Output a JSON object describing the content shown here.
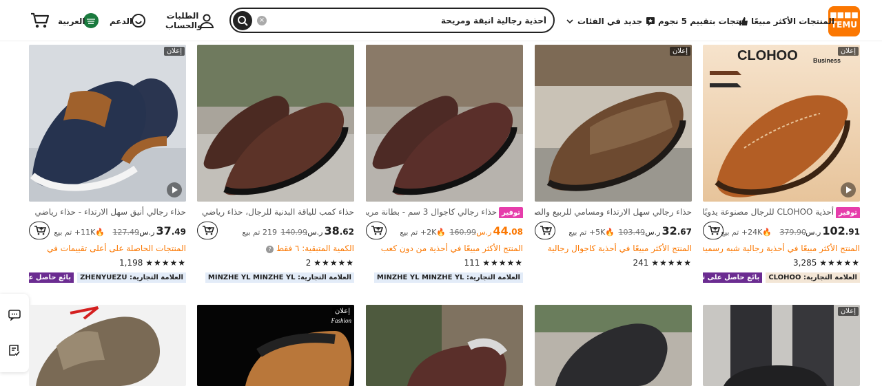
{
  "header": {
    "logo_top": "■■■■",
    "logo_bottom": "TEMU",
    "nav_best_sellers": "المنتجات الأكثر مبيعًا",
    "nav_five_star": "منتجات بتقييم 5 نجوم",
    "nav_new": "جديد في",
    "nav_categories": "الفئات",
    "search_value": "أحذية رجالية انيقة ومريحة",
    "orders_line1": "الطلبات",
    "orders_line2": "والحساب",
    "support": "الدعم",
    "language": "العربية"
  },
  "products": [
    {
      "ad": "إعلان",
      "save": "توفير",
      "title": "أحذية CLOHOO للرجال مصنوعة يدويًا",
      "price_int": "102",
      "price_dec": ".91",
      "currency": "ر.س.",
      "old_price": "379.90",
      "sold": "24K+ تم بيع",
      "tag": "المنتج الأكثر مبيعًا في أحذية رجالية شبه رسمية",
      "rating_count": "3,285",
      "brand": "العلامة التجارية: CLOHOO",
      "seller": "بائع حاصل على تقييمات"
    },
    {
      "ad": "إعلان",
      "title": "حذاء رجالي سهل الارتداء ومسامي للربيع والصيف",
      "price_int": "32",
      "price_dec": ".67",
      "currency": "ر.س.",
      "old_price": "103.49",
      "sold": "5K+ تم بيع",
      "tag": "المنتج الأكثر مبيعًا في أحذية كاجوال رجالية",
      "rating_count": "241"
    },
    {
      "save": "توفير",
      "title": "حذاء رجالي كاجوال 3 سم - بطانة مريحة",
      "price_int": "44",
      "price_dec": ".08",
      "currency": "ر.س.",
      "old_price": "160.99",
      "sold": "2K+ تم بيع",
      "tag": "المنتج الأكثر مبيعًا في أحذية من دون كعب",
      "rating_count": "111",
      "brand": "العلامة التجارية: MINZHE YL MINZHE YL"
    },
    {
      "title": "حذاء كمب للياقة البدنية للرجال، حذاء رياضي",
      "price_int": "38",
      "price_dec": ".62",
      "currency": "ر.س.",
      "old_price": "140.99",
      "sold": "219 تم بيع",
      "tag": "الكمية المتبقية: ٦ فقط",
      "rating_count": "2",
      "brand": "العلامة التجارية: MINZHE YL MINZHE YL"
    },
    {
      "ad": "إعلان",
      "title": "حذاء رجالي أنيق سهل الارتداء - حذاء رياضي",
      "price_int": "37",
      "price_dec": ".49",
      "currency": "ر.س.",
      "old_price": "127.49",
      "sold": "11K+ تم بيع",
      "tag": "المنتجات الحاصلة على أعلى تقييمات في",
      "rating_count": "1,198",
      "brand": "العلامة التجارية: ZHENYUEZU",
      "seller": "بائع حاصل على نجوم"
    }
  ],
  "second_row_ads": [
    "إعلان",
    "",
    "",
    "",
    "إعلان"
  ],
  "second_row_label": "Fashion",
  "stars": "★★★★★",
  "colors": {
    "accent": "#fb7701",
    "save": "#e63dab",
    "seller": "#6b2c91"
  }
}
